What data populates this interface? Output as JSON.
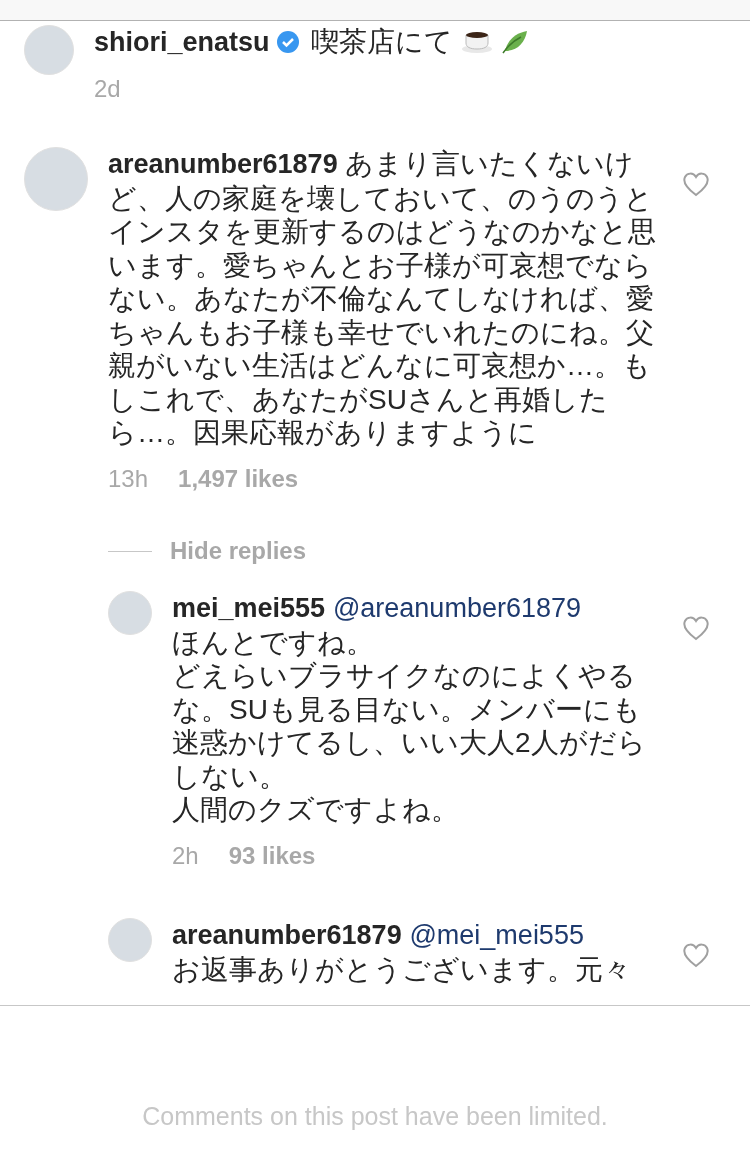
{
  "comments": [
    {
      "username": "shiori_enatsu",
      "verified": true,
      "text": "喫茶店にて",
      "time": "2d"
    },
    {
      "username": "areanumber61879",
      "text": "あまり言いたくないけど、人の家庭を壊しておいて、のうのうとインスタを更新するのはどうなのかなと思います。愛ちゃんとお子様が可哀想でならない。あなたが不倫なんてしなければ、愛ちゃんもお子様も幸せでいれたのにね。父親がいない生活はどんなに可哀想か…。もしこれで、あなたがSUさんと再婚したら…。因果応報がありますように",
      "time": "13h",
      "likes": "1,497 likes",
      "liked": false,
      "replies_toggle": "Hide replies",
      "replies": [
        {
          "username": "mei_mei555",
          "mention": "@areanumber61879",
          "lines": [
            "ほんとですね。",
            "どえらいブラサイクなのによくやるな。SUも見る目ない。メンバーにも迷惑かけてるし、いい大人2人がだらしない。",
            "人間のクズですよね。"
          ],
          "time": "2h",
          "likes": "93 likes",
          "liked": false
        },
        {
          "username": "areanumber61879",
          "mention": "@mei_mei555",
          "lines": [
            "お返事ありがとうございます。元々"
          ],
          "liked": false
        }
      ]
    }
  ],
  "footer": "Comments on this post have been limited."
}
